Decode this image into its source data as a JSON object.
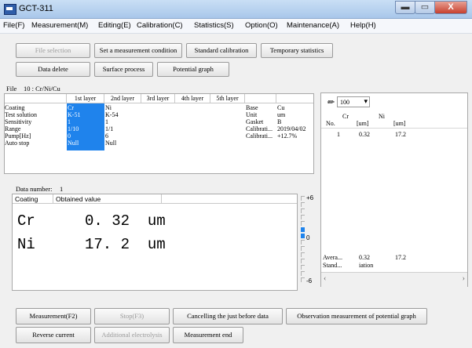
{
  "window": {
    "title": "GCT-311",
    "min_glyph": "▬",
    "max_glyph": "▭",
    "close_glyph": "X"
  },
  "menu": {
    "items": [
      "File(F)",
      "Measurement(M)",
      "Editing(E)",
      "Calibration(C)",
      "Statistics(S)",
      "Option(O)",
      "Maintenance(A)",
      "Help(H)"
    ]
  },
  "toolbar": {
    "file_selection": "File selection",
    "set_condition": "Set a measurement condition",
    "standard_calibration": "Standard calibration",
    "temporary_statistics": "Temporary statistics",
    "data_delete": "Data delete",
    "surface_process": "Surface process",
    "potential_graph": "Potential graph"
  },
  "file": {
    "label": "File",
    "value": "10 : Cr/Ni/Cu"
  },
  "layers": {
    "headers": [
      "1st layer",
      "2nd layer",
      "3rd layer",
      "4th layer",
      "5th layer"
    ],
    "row_labels": [
      "Coating",
      "Test solution",
      "Sensitivity",
      "Range",
      "Pump[Hz]",
      "Auto stop"
    ],
    "col1": [
      "Cr",
      "K-51",
      "1",
      "1/10",
      "0",
      "Null"
    ],
    "col2": [
      "Ni",
      "K-54",
      "1",
      "1/1",
      "6",
      "Null"
    ],
    "side_labels": [
      "Base",
      "Unit",
      "Gasket",
      "Calibrati...",
      "Calibrati..."
    ],
    "side_values": [
      "Cu",
      "um",
      "B",
      "2019/04/02",
      "+12.7%"
    ]
  },
  "data_number": {
    "label": "Data number:",
    "value": "1"
  },
  "obtained": {
    "col_coating": "Coating",
    "col_value": "Obtained value",
    "rows": [
      {
        "element": "Cr",
        "value": "0. 32  um"
      },
      {
        "element": "Ni",
        "value": "17. 2  um"
      }
    ]
  },
  "gauge": {
    "top": "+6",
    "mid": "0",
    "bottom": "-6"
  },
  "right_panel": {
    "count_value": "100",
    "col_no": "No.",
    "col_cr": "Cr",
    "col_ni": "Ni",
    "unit_cr": "[um]",
    "unit_ni": "[um]",
    "row": {
      "no": "1",
      "cr": "0.32",
      "ni": "17.2"
    },
    "avg_label": "Avera...",
    "avg_cr": "0.32",
    "avg_ni": "17.2",
    "std_label": "Stand...",
    "std_cr": "iation"
  },
  "bottom": {
    "measurement": "Measurement(F2)",
    "stop": "Stop(F3)",
    "cancel": "Cancelling the just before data",
    "observation": "Observation measurement of potential graph",
    "reverse_current": "Reverse current",
    "additional": "Additional electrolysis",
    "measurement_end": "Measurement end"
  },
  "colors": {
    "selection": "#1f83ec",
    "gauge_active": "#1f83ec"
  }
}
